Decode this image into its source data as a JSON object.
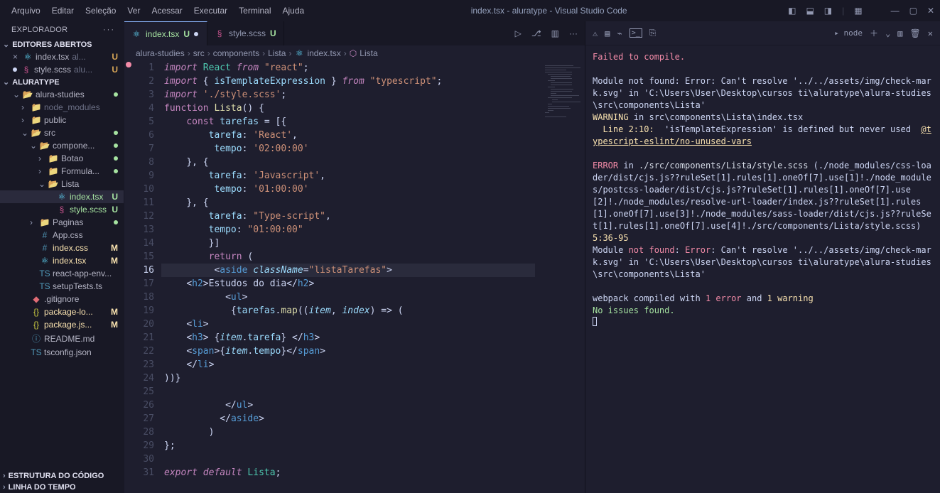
{
  "menubar": [
    "Arquivo",
    "Editar",
    "Seleção",
    "Ver",
    "Acessar",
    "Executar",
    "Terminal",
    "Ajuda"
  ],
  "window_title": "index.tsx - aluratype - Visual Studio Code",
  "explorer": {
    "title": "EXPLORADOR",
    "sections": {
      "open_editors": "EDITORES ABERTOS",
      "open_editor_items": [
        {
          "icon": "react",
          "name": "index.tsx",
          "hint": "al...",
          "status": "U"
        },
        {
          "icon": "scss",
          "name": "style.scss",
          "hint": "alu...",
          "status": "U"
        }
      ],
      "project": "ALURATYPE",
      "outline": "ESTRUTURA DO CÓDIGO",
      "timeline": "LINHA DO TEMPO"
    },
    "tree": [
      {
        "d": 1,
        "open": true,
        "icon": "folder-open",
        "name": "alura-studies",
        "dot": true
      },
      {
        "d": 2,
        "open": false,
        "icon": "folder",
        "name": "node_modules",
        "dim": true
      },
      {
        "d": 2,
        "open": false,
        "icon": "folder",
        "name": "public",
        "blue": true
      },
      {
        "d": 2,
        "open": true,
        "icon": "folder-open",
        "name": "src",
        "dot": true
      },
      {
        "d": 3,
        "open": true,
        "icon": "folder-open",
        "name": "compone...",
        "dot": true
      },
      {
        "d": 4,
        "open": false,
        "icon": "folder",
        "name": "Botao",
        "dot": true
      },
      {
        "d": 4,
        "open": false,
        "icon": "folder",
        "name": "Formula...",
        "dot": true
      },
      {
        "d": 4,
        "open": true,
        "icon": "folder-open",
        "name": "Lista"
      },
      {
        "d": 5,
        "icon": "react",
        "name": "index.tsx",
        "status": "U",
        "sel": true
      },
      {
        "d": 5,
        "icon": "scss",
        "name": "style.scss",
        "status": "U"
      },
      {
        "d": 3,
        "open": false,
        "icon": "folder",
        "name": "Paginas",
        "dot": true
      },
      {
        "d": 3,
        "icon": "css",
        "name": "App.css"
      },
      {
        "d": 3,
        "icon": "css",
        "name": "index.css",
        "status": "M"
      },
      {
        "d": 3,
        "icon": "react",
        "name": "index.tsx",
        "status": "M"
      },
      {
        "d": 3,
        "icon": "ts",
        "name": "react-app-env..."
      },
      {
        "d": 3,
        "icon": "ts",
        "name": "setupTests.ts"
      },
      {
        "d": 2,
        "icon": "git",
        "name": ".gitignore"
      },
      {
        "d": 2,
        "icon": "json",
        "name": "package-lo...",
        "status": "M"
      },
      {
        "d": 2,
        "icon": "json",
        "name": "package.js...",
        "status": "M"
      },
      {
        "d": 2,
        "icon": "md",
        "name": "README.md"
      },
      {
        "d": 2,
        "icon": "ts",
        "name": "tsconfig.json"
      }
    ]
  },
  "tabs": [
    {
      "icon": "react",
      "name": "index.tsx",
      "status": "U",
      "active": true,
      "dirty": true
    },
    {
      "icon": "scss",
      "name": "style.scss",
      "status": "U"
    }
  ],
  "breadcrumb": [
    "alura-studies",
    "src",
    "components",
    "Lista",
    "index.tsx",
    "Lista"
  ],
  "code_lines": [
    "<span class='kw'>import</span> <span class='cls'>React</span> <span class='kw'>from</span> <span class='str'>\"react\"</span><span class='pun'>;</span>",
    "<span class='kw'>import</span> <span class='pun'>{</span> <span class='prop'>isTemplateExpression</span> <span class='pun'>}</span> <span class='kw'>from</span> <span class='str'>\"typescript\"</span><span class='pun'>;</span>",
    "<span class='kw'>import</span> <span class='str'>'./style.scss'</span><span class='pun'>;</span>",
    "<span class='kw2'>function</span> <span class='fn'>Lista</span><span class='pun'>() {</span>",
    "    <span class='kw2'>const</span> <span class='prop'>tarefas</span> <span class='pun'>= [{</span>",
    "        <span class='prop'>tarefa</span><span class='pun'>:</span> <span class='str'>'React'</span><span class='pun'>,</span>",
    "         <span class='prop'>tempo</span><span class='pun'>:</span> <span class='str'>'02:00:00'</span>",
    "    <span class='pun'>}, {</span>",
    "        <span class='prop'>tarefa</span><span class='pun'>:</span> <span class='str'>'Javascript'</span><span class='pun'>,</span>",
    "         <span class='prop'>tempo</span><span class='pun'>:</span> <span class='str'>'01:00:00'</span>",
    "    <span class='pun'>}, {</span>",
    "        <span class='prop'>tarefa</span><span class='pun'>:</span> <span class='str'>\"Type-script\"</span><span class='pun'>,</span>",
    "        <span class='prop'>tempo</span><span class='pun'>:</span> <span class='str'>\"01:00:00\"</span>",
    "        <span class='pun'>}]</span>",
    "        <span class='kw2'>return</span> <span class='pun'>(</span>",
    "         <span class='pun'>&lt;</span><span class='tag'>aside</span> <span class='attr'>className</span><span class='pun'>=</span><span class='str'>\"listaTarefas\"</span><span class='pun'>&gt;</span>",
    "    <span class='pun'>&lt;</span><span class='tag'>h2</span><span class='pun'>&gt;</span>Estudos do dia<span class='pun'>&lt;/</span><span class='tag'>h2</span><span class='pun'>&gt;</span>",
    "           <span class='pun'>&lt;</span><span class='tag'>ul</span><span class='pun'>&gt;</span>",
    "            <span class='pun'>{</span><span class='prop'>tarefas</span><span class='pun'>.</span><span class='fn'>map</span><span class='pun'>((</span><span class='attr'>item</span><span class='pun'>,</span> <span class='attr'>index</span><span class='pun'>) =&gt; (</span>",
    "    <span class='pun'>&lt;</span><span class='tag'>li</span><span class='pun'>&gt;</span>",
    "    <span class='pun'>&lt;</span><span class='tag'>h3</span><span class='pun'>&gt; {</span><span class='attr'>item</span><span class='pun'>.</span><span class='prop'>tarefa</span><span class='pun'>} &lt;/</span><span class='tag'>h3</span><span class='pun'>&gt;</span>",
    "    <span class='pun'>&lt;</span><span class='tag'>span</span><span class='pun'>&gt;{</span><span class='attr'>item</span><span class='pun'>.</span><span class='prop'>tempo</span><span class='pun'>}&lt;/</span><span class='tag'>span</span><span class='pun'>&gt;</span>",
    "    <span class='pun'>&lt;/</span><span class='tag'>li</span><span class='pun'>&gt;</span>",
    "<span class='pun'>))}</span>",
    " ",
    "           <span class='pun'>&lt;/</span><span class='tag'>ul</span><span class='pun'>&gt;</span>",
    "          <span class='pun'>&lt;/</span><span class='tag'>aside</span><span class='pun'>&gt;</span>",
    "        <span class='pun'>)</span>",
    "<span class='pun'>};</span>",
    " ",
    "<span class='kw'>export</span> <span class='kw'>default</span> <span class='cls'>Lista</span><span class='pun'>;</span>"
  ],
  "active_line": 16,
  "terminal": {
    "shell": "node",
    "lines": [
      "<span class='red'>Failed to compile.</span>",
      "",
      "Module not found: Error: Can't resolve '../../assets/img/check-mark.svg' in 'C:\\Users\\User\\Desktop\\cursos ti\\aluratype\\alura-studies\\src\\components\\Lista'",
      "<span class='yel'>WARNING</span> in src\\components\\Lista\\index.tsx",
      "  <span class='yel'>Line 2:10:</span>  'isTemplateExpression' is defined but never used  <span class='lnk'>@typescript-eslint/no-unused-vars</span>",
      "",
      "<span class='red'>ERROR</span> in <span style='color:#d8dee9'>./src/components/Lista/style.scss</span> (./node_modules/css-loader/dist/cjs.js??ruleSet[1].rules[1].oneOf[7].use[1]!./node_modules/postcss-loader/dist/cjs.js??ruleSet[1].rules[1].oneOf[7].use[2]!./node_modules/resolve-url-loader/index.js??ruleSet[1].rules[1].oneOf[7].use[3]!./node_modules/sass-loader/dist/cjs.js??ruleSet[1].rules[1].oneOf[7].use[4]!./src/components/Lista/style.scss) <span class='yel'>5:36-95</span>",
      "Module <span class='red'>not found</span>: <span class='red'>Error</span>: Can't resolve '../../assets/img/check-mark.svg' in 'C:\\Users\\User\\Desktop\\cursos ti\\aluratype\\alura-studies\\src\\components\\Lista'",
      "",
      "webpack compiled with <span class='red'>1 error</span> and <span class='yel'>1 warning</span>",
      "<span class='grn'>No issues found.</span>",
      "<span style='border:1px solid #cdd6f4;display:inline-block;width:6px;height:13px;'></span>"
    ]
  }
}
